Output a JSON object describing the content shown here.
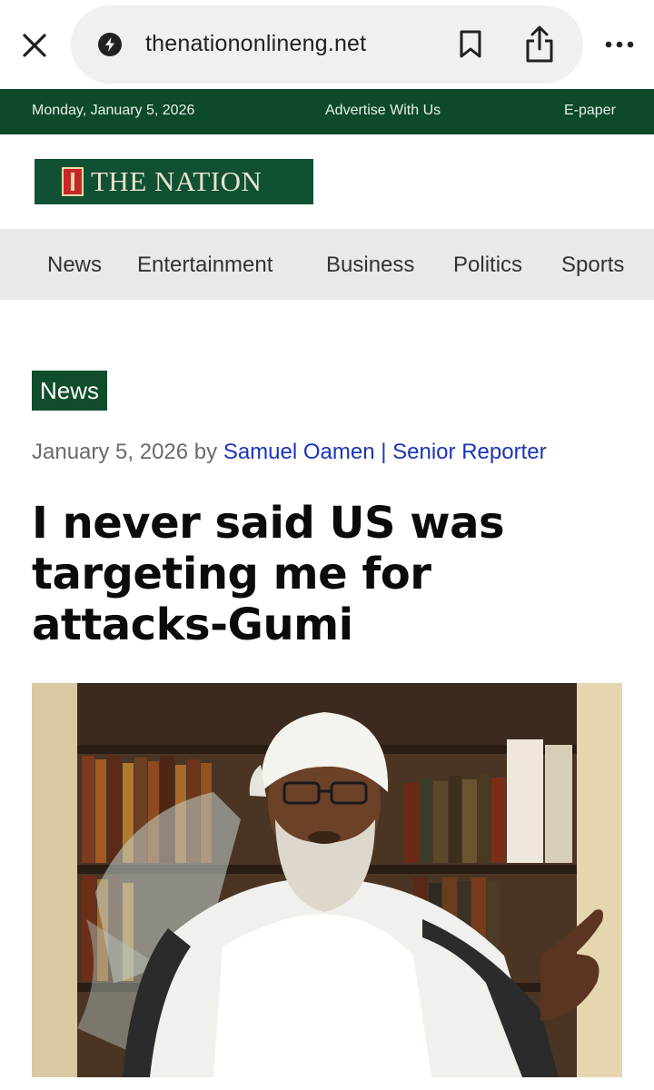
{
  "browser": {
    "url": "thenationonlineng.net",
    "icons": [
      "close-icon",
      "lightning-site-icon",
      "bookmark-icon",
      "share-icon",
      "more-dots-icon"
    ]
  },
  "top_bar": {
    "date": "Monday, January 5, 2026",
    "advertise": "Advertise With Us",
    "epaper": "E-paper"
  },
  "logo": {
    "text": "THE NATION"
  },
  "nav": {
    "items": [
      {
        "label": "News"
      },
      {
        "label": "Entertainment"
      },
      {
        "label": "Business"
      },
      {
        "label": "Politics"
      },
      {
        "label": "Sports"
      }
    ]
  },
  "article": {
    "category": "News",
    "date": "January 5, 2026",
    "by": "by",
    "author": "Samuel Oamen | Senior Reporter",
    "headline": "I never said US was targeting me for attacks-Gumi"
  },
  "colors": {
    "brand_green": "#0d4a2a",
    "author_link": "#1a35b8",
    "nav_bg": "#e9e9e9"
  }
}
